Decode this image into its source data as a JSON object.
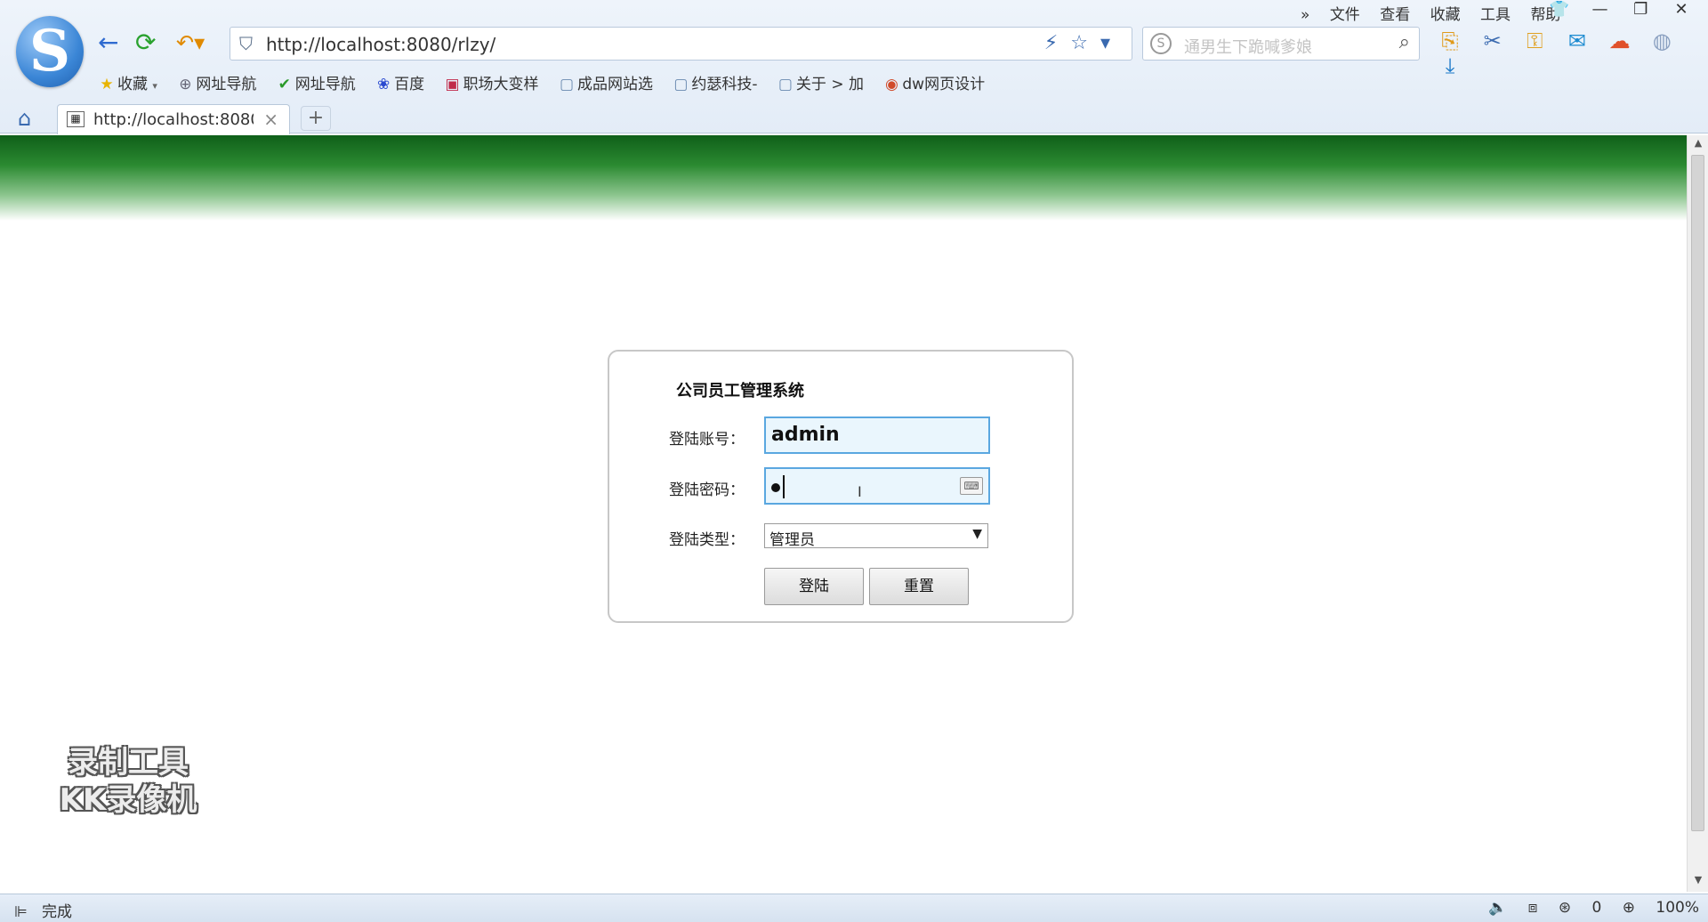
{
  "browser": {
    "menu": [
      "文件",
      "查看",
      "收藏",
      "工具",
      "帮助"
    ],
    "menu_more": "»",
    "address": "http://localhost:8080/rlzy/",
    "search_placeholder": "通男生下跪喊爹娘",
    "bookmarks": [
      {
        "label": "收藏",
        "icon": "★"
      },
      {
        "label": "网址导航",
        "icon": "⊕"
      },
      {
        "label": "网址导航",
        "icon": "✔"
      },
      {
        "label": "百度",
        "icon": "❀"
      },
      {
        "label": "职场大变样",
        "icon": "▣"
      },
      {
        "label": "成品网站选",
        "icon": "▢"
      },
      {
        "label": "约瑟科技-",
        "icon": "▢"
      },
      {
        "label": "关于 > 加",
        "icon": "▢"
      },
      {
        "label": "dw网页设计",
        "icon": "◉"
      }
    ],
    "tab": {
      "title": "http://localhost:8080/rl"
    },
    "new_tab": "+",
    "status": "完成",
    "status_right": {
      "notices": "0",
      "zoom": "100%"
    }
  },
  "login": {
    "system_title": "公司员工管理系统",
    "account_label": "登陆账号：",
    "account_value": "admin",
    "password_label": "登陆密码：",
    "type_label": "登陆类型：",
    "type_value": "管理员",
    "login_button": "登陆",
    "reset_button": "重置"
  },
  "watermark": {
    "line1": "录制工具",
    "line2": "KK录像机"
  },
  "colors": {
    "banner_dark": "#0f5f19",
    "input_border": "#5aa7e0",
    "input_bg": "#eaf6fd"
  }
}
